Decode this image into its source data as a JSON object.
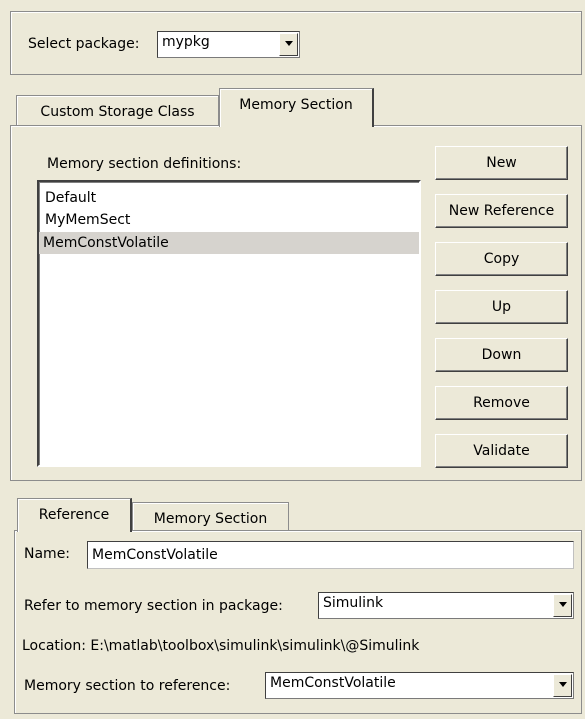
{
  "package_selector": {
    "label": "Select package:",
    "value": "mypkg"
  },
  "top_tabs": [
    {
      "label": "Custom Storage Class",
      "active": false
    },
    {
      "label": "Memory Section",
      "active": true
    }
  ],
  "memory_section_panel": {
    "list_label": "Memory section definitions:",
    "items": [
      {
        "label": "Default",
        "selected": false
      },
      {
        "label": "MyMemSect",
        "selected": false
      },
      {
        "label": "MemConstVolatile",
        "selected": true
      }
    ],
    "buttons": {
      "new": "New",
      "new_reference": "New Reference",
      "copy": "Copy",
      "up": "Up",
      "down": "Down",
      "remove": "Remove",
      "validate": "Validate"
    }
  },
  "bottom_tabs": [
    {
      "label": "Reference",
      "active": true
    },
    {
      "label": "Memory Section",
      "active": false
    }
  ],
  "reference_panel": {
    "name_label": "Name:",
    "name_value": "MemConstVolatile",
    "package_label": "Refer to memory section in package:",
    "package_value": "Simulink",
    "location_text": "Location: E:\\matlab\\toolbox\\simulink\\simulink\\@Simulink",
    "section_label": "Memory section to reference:",
    "section_value": "MemConstVolatile"
  }
}
